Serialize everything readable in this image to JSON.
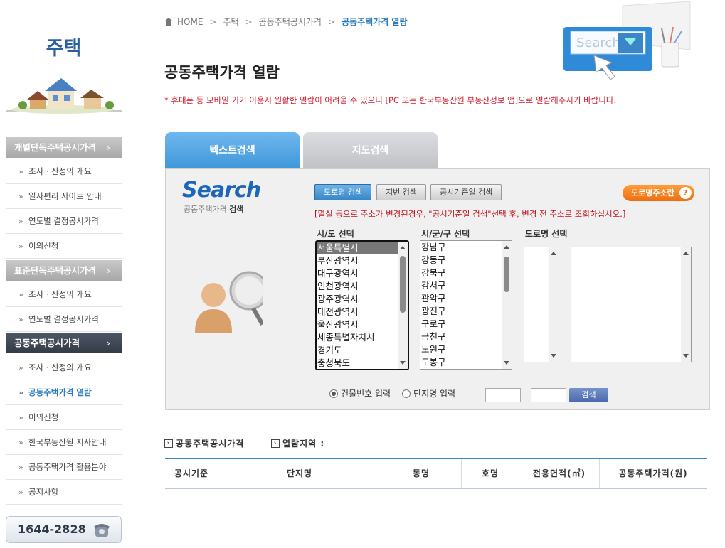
{
  "sidebar": {
    "title": "주택",
    "sections": [
      {
        "label": "개별단독주택공시가격"
      },
      {
        "label": "표준단독주택공시가격"
      },
      {
        "label": "공동주택공시가격"
      }
    ],
    "items_a": [
      "조사 · 산정의 개요",
      "일사편리 사이트 안내",
      "연도별 결정공시가격",
      "이의신청"
    ],
    "items_b": [
      "조사 · 산정의 개요",
      "연도별 결정공시가격"
    ],
    "items_c": [
      "조사 · 산정의 개요",
      "공동주택가격 열람",
      "이의신청",
      "한국부동산원 지사안내",
      "공동주택가격 활용분야",
      "공지사항"
    ],
    "phone": "1644-2828",
    "chevron": "›"
  },
  "breadcrumb": {
    "home": "HOME",
    "level1": "주택",
    "level2": "공동주택공시가격",
    "current": "공동주택가격 열람",
    "sep": ">"
  },
  "page": {
    "title": "공동주택가격 열람",
    "notice": "* 휴대폰 등 모바일 기기 이용시 원활한 열람이 어려울 수 있으니 [PC 또는 한국부동산원 부동산정보 앱]으로 열람해주시기 바랍니다.",
    "deco_text": "Search"
  },
  "tabs": {
    "text_search": "텍스트검색",
    "map_search": "지도검색"
  },
  "search": {
    "logo": "Search",
    "logo_sub": "공동주택가격",
    "logo_sub_bold": "검색",
    "btn_road": "도로명 검색",
    "btn_lot": "지번 검색",
    "btn_date": "공시기준일 검색",
    "btn_addr": "도로명주소란",
    "btn_addr_q": "?",
    "warning": "[멸실 등으로 주소가 변경된경우, \"공시기준일 검색\"선택 후, 변경 전 주소로 조회하십시오.]",
    "label_sido": "시/도 선택",
    "label_sigungu": "시/군/구 선택",
    "label_road": "도로명 선택",
    "sido": [
      "서울특별시",
      "부산광역시",
      "대구광역시",
      "인천광역시",
      "광주광역시",
      "대전광역시",
      "울산광역시",
      "세종특별자치시",
      "경기도",
      "충청북도"
    ],
    "sigungu": [
      "강남구",
      "강동구",
      "강북구",
      "강서구",
      "관악구",
      "광진구",
      "구로구",
      "금천구",
      "노원구",
      "도봉구"
    ],
    "radio_building": "건물번호 입력",
    "radio_complex": "단지명 입력",
    "dash": "-",
    "btn_search": "검색"
  },
  "result": {
    "head1": "공동주택공시가격",
    "head2": "열람지역 :",
    "columns": [
      "공시기준",
      "단지명",
      "동명",
      "호명",
      "전용면적(㎡)",
      "공동주택가격(원)"
    ]
  }
}
